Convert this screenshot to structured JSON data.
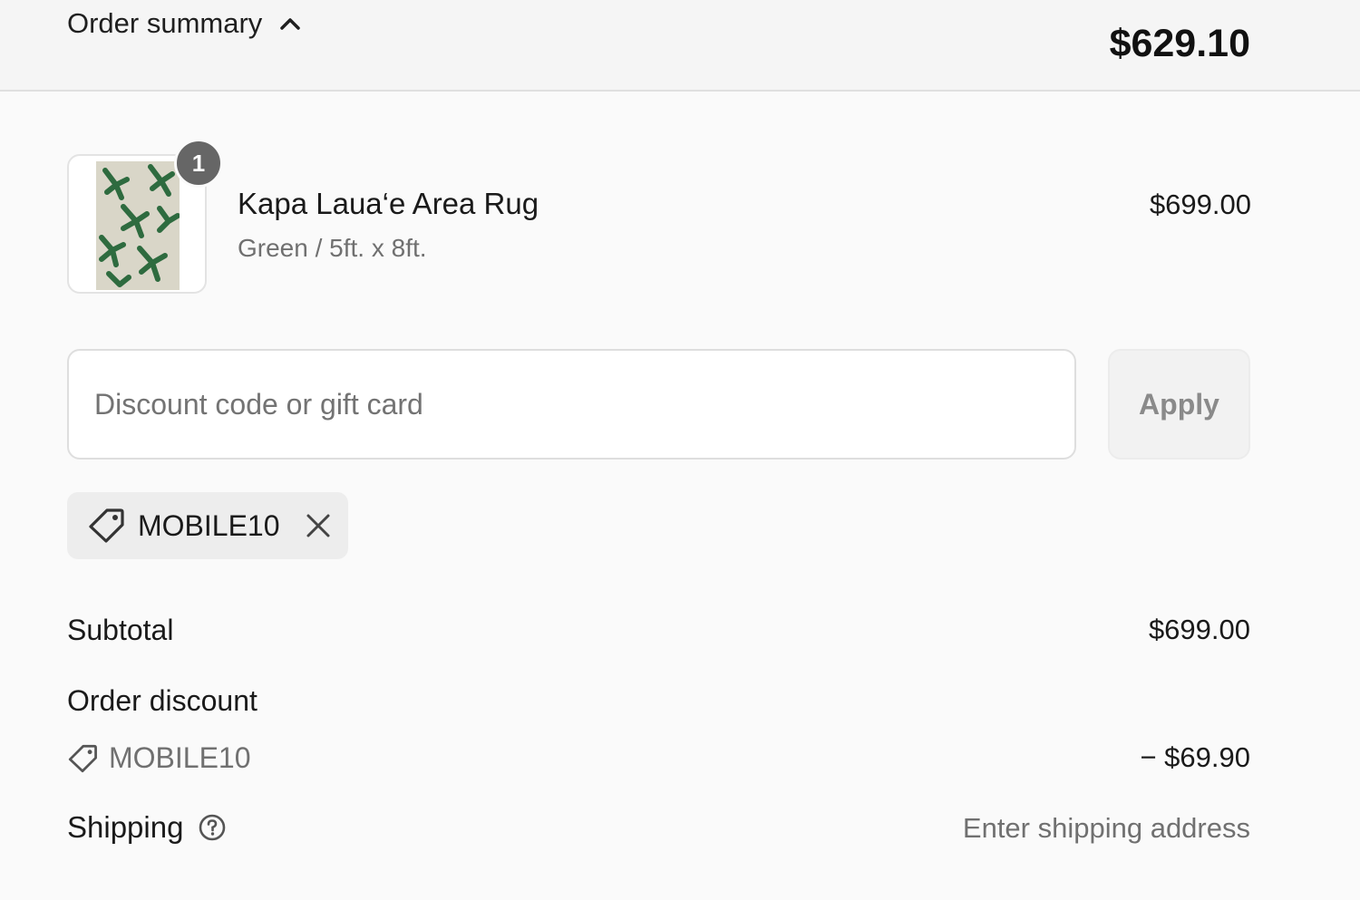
{
  "header": {
    "toggle_label": "Order summary",
    "total": "$629.10"
  },
  "product": {
    "name": "Kapa Laua‘e Area Rug",
    "variant": "Green / 5ft. x 8ft.",
    "price": "$699.00",
    "quantity": "1",
    "image_icon": "rug-thumbnail"
  },
  "discount": {
    "placeholder": "Discount code or gift card",
    "value": "",
    "apply_label": "Apply",
    "applied_code": "MOBILE10"
  },
  "totals": {
    "subtotal_label": "Subtotal",
    "subtotal_value": "$699.00",
    "order_discount_label": "Order discount",
    "order_discount_code": "MOBILE10",
    "order_discount_value": "− $69.90",
    "shipping_label": "Shipping",
    "shipping_value": "Enter shipping address"
  },
  "colors": {
    "header_bg": "#f5f5f5",
    "page_bg": "#fafafa",
    "badge_bg": "#666666",
    "rug_leaf": "#2e6b3f"
  }
}
